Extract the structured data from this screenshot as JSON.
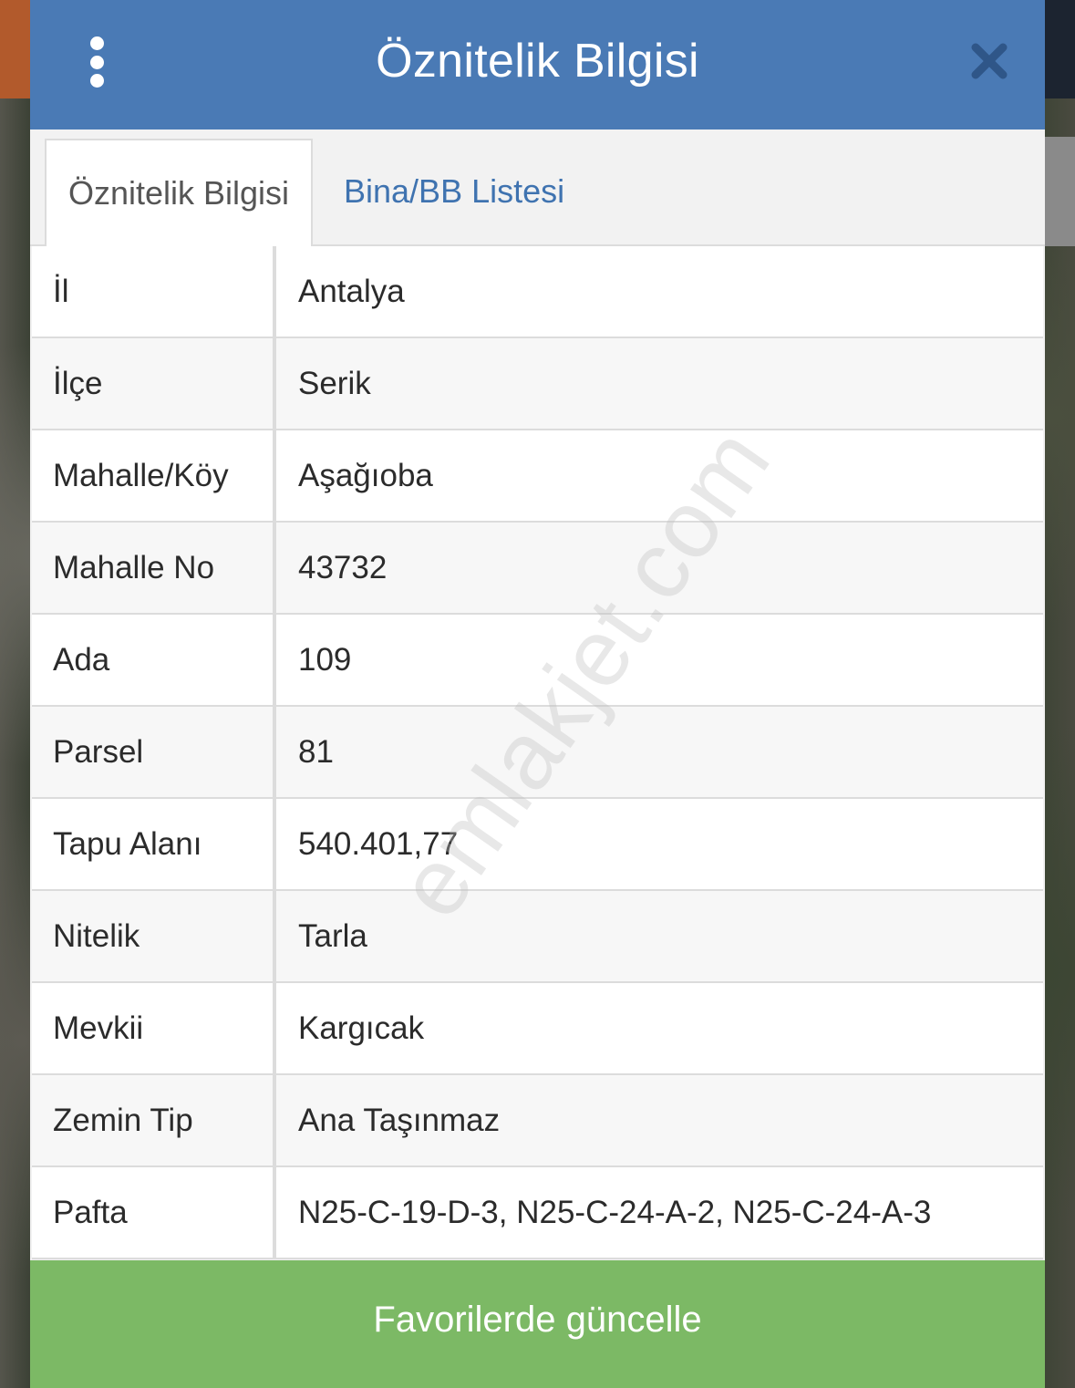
{
  "dialog": {
    "title": "Öznitelik Bilgisi",
    "menu_icon": "vertical-dots-icon",
    "close_icon": "close-icon"
  },
  "tabs": [
    {
      "label": "Öznitelik Bilgisi",
      "active": true
    },
    {
      "label": "Bina/BB Listesi",
      "active": false
    }
  ],
  "attributes": [
    {
      "key": "İl",
      "value": "Antalya"
    },
    {
      "key": "İlçe",
      "value": "Serik"
    },
    {
      "key": "Mahalle/Köy",
      "value": "Aşağıoba"
    },
    {
      "key": "Mahalle No",
      "value": "43732"
    },
    {
      "key": "Ada",
      "value": "109"
    },
    {
      "key": "Parsel",
      "value": "81"
    },
    {
      "key": "Tapu Alanı",
      "value": "540.401,77"
    },
    {
      "key": "Nitelik",
      "value": "Tarla"
    },
    {
      "key": "Mevkii",
      "value": "Kargıcak"
    },
    {
      "key": "Zemin Tip",
      "value": "Ana Taşınmaz"
    },
    {
      "key": "Pafta",
      "value": "N25-C-19-D-3, N25-C-24-A-2, N25-C-24-A-3"
    }
  ],
  "watermark": "emlakjet.com",
  "footer": {
    "button_label": "Favorilerde güncelle"
  },
  "colors": {
    "header": "#4a7ab5",
    "tab_link": "#3f73b0",
    "footer_button": "#7cb965"
  }
}
